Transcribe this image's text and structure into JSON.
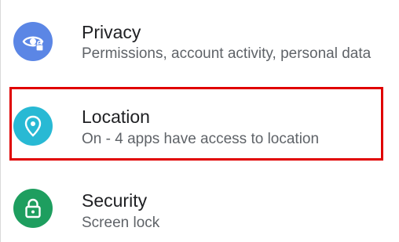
{
  "settings": {
    "items": [
      {
        "title": "Privacy",
        "subtitle": "Permissions, account activity, personal data",
        "icon": "privacy-eye-lock-icon",
        "icon_color": "#5b86e5"
      },
      {
        "title": "Location",
        "subtitle": "On - 4 apps have access to location",
        "icon": "location-pin-icon",
        "icon_color": "#28b9d4"
      },
      {
        "title": "Security",
        "subtitle": "Screen lock",
        "icon": "lock-icon",
        "icon_color": "#1e9e5f"
      }
    ]
  },
  "highlight": {
    "target": "Location",
    "color": "#e00000"
  }
}
